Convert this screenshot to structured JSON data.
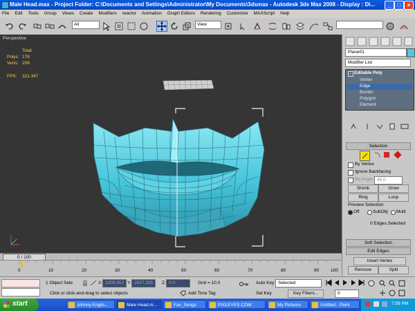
{
  "window": {
    "title": "Male Head.max   - Project Folder: C:\\Documents and Settings\\Administrator\\My Documents\\3dsmax   - Autodesk 3ds Max 2008    - Display : Di..."
  },
  "menu": [
    "File",
    "Edit",
    "Tools",
    "Group",
    "Views",
    "Create",
    "Modifiers",
    "reactor",
    "Animation",
    "Graph Editors",
    "Rendering",
    "Customize",
    "MAXScript",
    "Help"
  ],
  "toolbar": {
    "selection_filter": "All",
    "ref_coord": "View"
  },
  "viewport": {
    "label": "Perspective",
    "stats_header": "Total",
    "polys_label": "Polys:",
    "polys_value": "178",
    "verts_label": "Verts:",
    "verts_value": "208",
    "fps_label": "FPS:",
    "fps_value": "321.347"
  },
  "command_panel": {
    "object_name": "Plane01",
    "modifier_list": "Modifier List",
    "stack": {
      "root": "Editable Poly",
      "items": [
        "Vertex",
        "Edge",
        "Border",
        "Polygon",
        "Element"
      ],
      "selected_index": 1
    },
    "selection": {
      "title": "Selection",
      "by_vertex": "By Vertex",
      "ignore_backfacing": "Ignore Backfacing",
      "by_angle": "By Angle:",
      "angle_value": "45.0",
      "shrink": "Shrink",
      "grow": "Grow",
      "ring": "Ring",
      "loop": "Loop",
      "preview_title": "Preview Selection",
      "preview_off": "Off",
      "preview_subobj": "SubObj",
      "preview_multi": "Multi",
      "status": "0 Edges Selected"
    },
    "soft_selection": "Soft Selection",
    "edit_edges": "Edit Edges",
    "insert_vertex": "Insert Vertex",
    "remove": "Remove",
    "split": "Split"
  },
  "timeline": {
    "slider": "0 / 100",
    "ticks": [
      "0",
      "10",
      "20",
      "30",
      "40",
      "50",
      "60",
      "70",
      "80",
      "90",
      "100"
    ]
  },
  "status": {
    "selection": "1 Object Sele",
    "x_label": "X:",
    "x_value": "1009.952",
    "y_label": "Y:",
    "y_value": "2627.295",
    "z_label": "Z:",
    "z_value": "0.0",
    "grid": "Grid = 10.0",
    "autokey": "Auto Key",
    "selected": "Selected",
    "setkey": "Set Key",
    "key_filters": "Key Filters...",
    "frame": "0",
    "prompt": "Click or click-and-drag to select objects",
    "add_time_tag": "Add Time Tag"
  },
  "taskbar": {
    "start": "start",
    "tasks": [
      "Johnny Englis...",
      "Male Head.m...",
      "Fav_Songs",
      "PIXLEYES.COM",
      "My Pictures",
      "Untitled - Paint"
    ],
    "active_index": 1,
    "clock": "7:59 PM"
  }
}
